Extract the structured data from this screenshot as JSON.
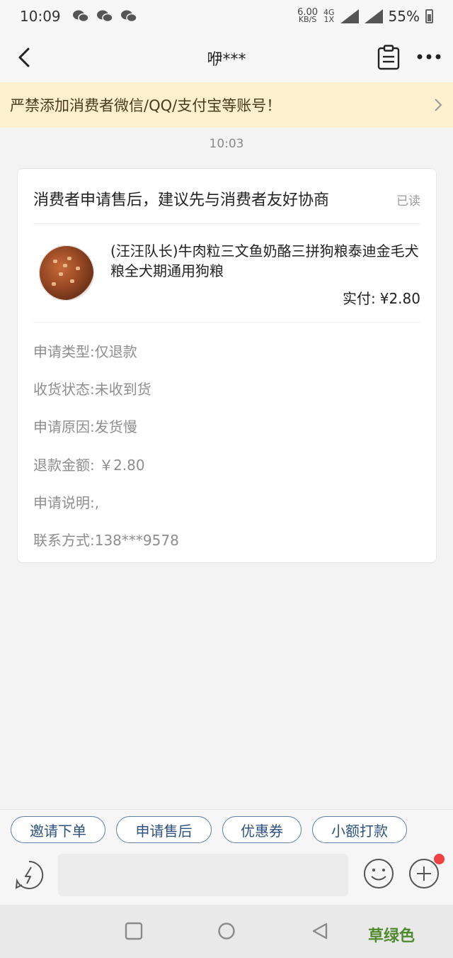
{
  "status_bar": {
    "time": "10:09",
    "net_speed_value": "6.00",
    "net_speed_unit": "KB/S",
    "network_top": "4G",
    "network_bottom": "1X",
    "battery": "55%"
  },
  "nav": {
    "title": "咿***"
  },
  "warning": {
    "text": "严禁添加消费者微信/QQ/支付宝等账号！"
  },
  "chat": {
    "timestamp": "10:03"
  },
  "card": {
    "title": "消费者申请售后，建议先与消费者友好协商",
    "read_status": "已读",
    "product_name": "(汪汪队长)牛肉粒三文鱼奶酪三拼狗粮泰迪金毛犬粮全犬期通用狗粮",
    "paid_label": "实付:",
    "paid_amount": "¥2.80",
    "rows": [
      "申请类型:仅退款",
      "收货状态:未收到货",
      "申请原因:发货慢",
      "退款金额: ￥2.80",
      "申请说明:,",
      "联系方式:138***9578"
    ]
  },
  "quick_actions": [
    "邀请下单",
    "申请售后",
    "优惠券",
    "小额打款"
  ],
  "watermark": "草绿色",
  "colors": {
    "warning_bg": "#fdf0cf",
    "button_border": "#5f7fa3",
    "button_text": "#2d527f",
    "badge": "#f04040",
    "watermark": "#4f8a2f"
  },
  "icons": {
    "back": "chevron-left-icon",
    "clipboard": "clipboard-icon",
    "more": "more-horizontal-icon",
    "lightning": "lightning-icon",
    "emoji": "emoji-icon",
    "plus": "plus-icon"
  }
}
